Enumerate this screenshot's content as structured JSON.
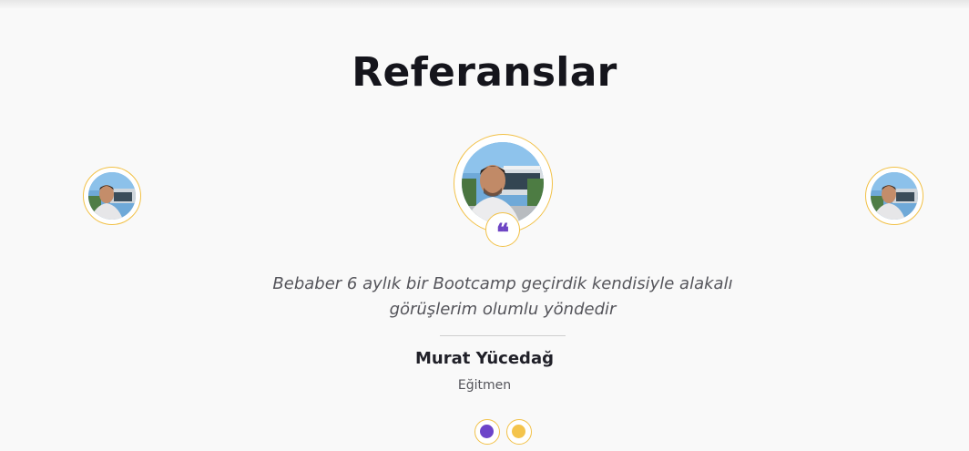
{
  "section": {
    "title": "Referanslar"
  },
  "testimonial": {
    "quote_line_1": "Bebaber 6 aylık bir Bootcamp geçirdik kendisiyle alakalı",
    "quote_line_2": "görüşlerim olumlu yöndedir",
    "author_name": "Murat Yücedağ",
    "author_role": "Eğitmen",
    "quote_icon": "quote-icon"
  },
  "pagination": {
    "active_index": 0,
    "dots": [
      {
        "color": "#6c44c9"
      },
      {
        "color": "#f4c44c"
      }
    ]
  },
  "colors": {
    "accent_yellow": "#f2c147",
    "accent_purple": "#6e45c4",
    "background": "#f9f9f9"
  }
}
